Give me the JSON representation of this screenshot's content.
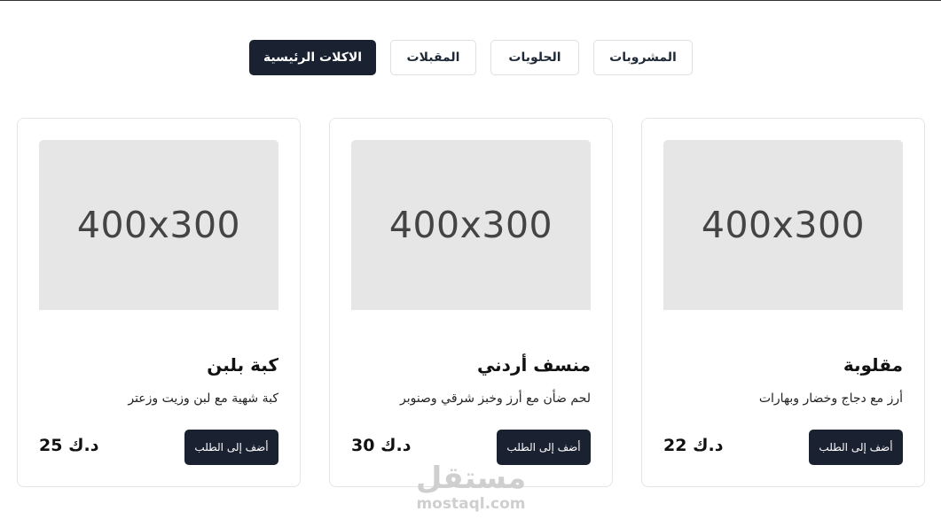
{
  "tabs": [
    {
      "label": "المشروبات"
    },
    {
      "label": "الحلويات"
    },
    {
      "label": "المقبلات"
    },
    {
      "label": "الاكلات الرئيسية",
      "active": true
    }
  ],
  "products": [
    {
      "image_placeholder": "400x300",
      "title": "كبة بلبن",
      "description": "كبة شهية مع لبن وزيت وزعتر",
      "price_amount": "25",
      "price_currency": "د.ك",
      "add_label": "أضف إلى الطلب"
    },
    {
      "image_placeholder": "400x300",
      "title": "منسف أردني",
      "description": "لحم ضأن مع أرز وخبز شرقي وصنوبر",
      "price_amount": "30",
      "price_currency": "د.ك",
      "add_label": "أضف إلى الطلب"
    },
    {
      "image_placeholder": "400x300",
      "title": "مقلوبة",
      "description": "أرز مع دجاج وخضار وبهارات",
      "price_amount": "22",
      "price_currency": "د.ك",
      "add_label": "أضف إلى الطلب"
    }
  ],
  "watermark": {
    "arabic": "مستقل",
    "latin": "mostaql.com"
  },
  "colors": {
    "accent": "#1a2130",
    "placeholder_bg": "#e6e6e6",
    "border": "#e3e5e9"
  }
}
